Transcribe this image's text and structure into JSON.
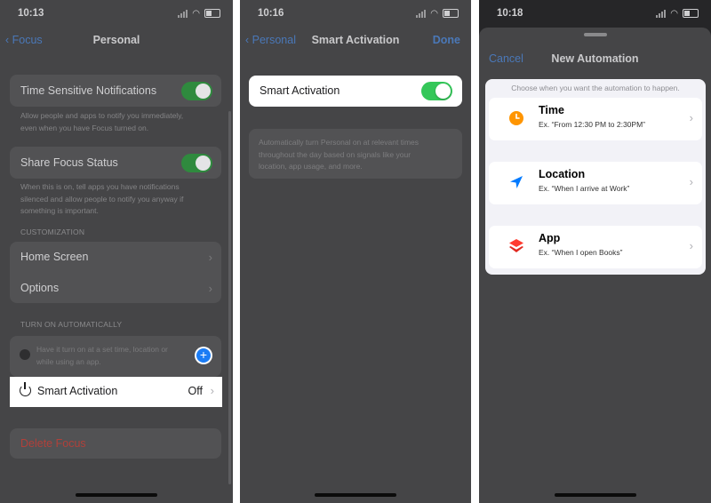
{
  "screen1": {
    "time": "10:13",
    "back_label": "Focus",
    "title": "Personal",
    "time_sensitive_label": "Time Sensitive Notifications",
    "time_sensitive_desc": [
      "Allow people and apps to notify you immediately,",
      "even when you have Focus turned on."
    ],
    "share_focus_label": "Share Focus Status",
    "share_focus_desc": [
      "When this is on, tell apps you have notifications",
      "silenced and allow people to notify you anyway if",
      "something is important."
    ],
    "customization_header": "CUSTOMIZATION",
    "home_screen_label": "Home Screen",
    "options_label": "Options",
    "turn_on_header": "TURN ON AUTOMATICALLY",
    "automation_hint": [
      "Have it turn on at a set time, location or",
      "while using an app."
    ],
    "smart_activation_label": "Smart Activation",
    "smart_activation_value": "Off",
    "delete_label": "Delete Focus"
  },
  "screen2": {
    "time": "10:16",
    "back_label": "Personal",
    "title": "Smart Activation",
    "done_label": "Done",
    "toggle_label": "Smart Activation",
    "description": [
      "Automatically turn Personal on at relevant times",
      "throughout the day based on signals like your",
      "location, app usage, and more."
    ]
  },
  "screen3": {
    "time": "10:18",
    "cancel_label": "Cancel",
    "title": "New Automation",
    "header": "Choose when you want the automation to happen.",
    "options": [
      {
        "title": "Time",
        "subtitle": "Ex. “From 12:30 PM to 2:30PM”",
        "icon": "clock-icon",
        "color": "#ff9500"
      },
      {
        "title": "Location",
        "subtitle": "Ex. “When I arrive at Work”",
        "icon": "location-arrow-icon",
        "color": "#007aff"
      },
      {
        "title": "App",
        "subtitle": "Ex. “When I open Books”",
        "icon": "app-layers-icon",
        "color": "#ff3b30"
      }
    ]
  },
  "colors": {
    "accent_blue": "#4a78b8",
    "toggle_green": "#34c759",
    "destructive_red": "#b0403a"
  }
}
